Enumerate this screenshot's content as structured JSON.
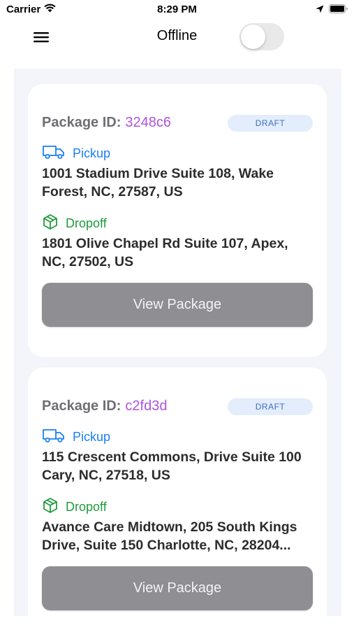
{
  "status_bar": {
    "carrier": "Carrier",
    "time": "8:29 PM"
  },
  "nav": {
    "title": "Offline",
    "online_toggle_on": false
  },
  "packages": [
    {
      "id_label": "Package ID:",
      "id": "3248c6",
      "status": "DRAFT",
      "pickup_label": "Pickup",
      "pickup_address_line1": "1001 Stadium Drive Suite 108, Wake",
      "pickup_address_line2": "Forest, NC, 27587, US",
      "dropoff_label": "Dropoff",
      "dropoff_address_line1": "1801 Olive Chapel Rd Suite 107, Apex,",
      "dropoff_address_line2": "NC, 27502, US",
      "button_label": "View Package"
    },
    {
      "id_label": "Package ID:",
      "id": "c2fd3d",
      "status": "DRAFT",
      "pickup_label": "Pickup",
      "pickup_address_line1": "115 Crescent Commons, Drive Suite 100",
      "pickup_address_line2": "Cary, NC, 27518, US",
      "dropoff_label": "Dropoff",
      "dropoff_address_line1": "Avance Care Midtown, 205 South Kings",
      "dropoff_address_line2": "Drive, Suite 150 Charlotte, NC, 28204...",
      "button_label": "View Package"
    }
  ],
  "colors": {
    "pickup": "#1a7ff5",
    "dropoff": "#1e9b3c",
    "package_id": "#af52de",
    "button": "#8e8e93",
    "list_background": "#f3f5fa"
  },
  "icons": {
    "menu": "hamburger-menu-icon",
    "pickup": "truck-icon",
    "dropoff": "package-box-icon"
  }
}
